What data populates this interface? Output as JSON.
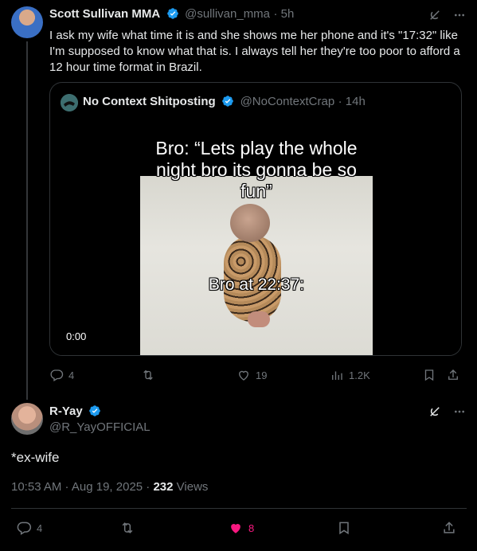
{
  "tweet": {
    "author_name": "Scott Sullivan MMA",
    "author_handle": "@sullivan_mma",
    "time": "· 5h",
    "text": "I ask my wife what time it is and she shows me her phone and it's \"17:32\" like I'm supposed to know what that is. I always tell her they're too poor to afford a 12 hour time format in Brazil.",
    "quote": {
      "author_name": "No Context Shitposting",
      "author_handle": "@NoContextCrap",
      "time": "· 14h",
      "caption_top": "Bro: “Lets play the whole night bro its gonna be so fun”",
      "caption_mid": "Bro at 22:37:",
      "video_time": "0:00"
    },
    "actions": {
      "replies": "4",
      "reposts": "",
      "likes": "19",
      "views": "1.2K"
    }
  },
  "reply": {
    "author_name": "R-Yay",
    "author_handle": "@R_YayOFFICIAL",
    "text": "*ex-wife",
    "timestamp": "10:53 AM · Aug 19, 2025 · ",
    "views_count": "232",
    "views_label": " Views",
    "actions": {
      "replies": "4",
      "reposts": "",
      "likes": "8"
    }
  },
  "colors": {
    "background": "#000000",
    "text": "#e7e9ea",
    "muted": "#71767b",
    "border": "#2f3336",
    "verified": "#1d9bf0",
    "like": "#f91880"
  },
  "icons": [
    "verified-badge-icon",
    "grok-icon",
    "more-icon",
    "reply-icon",
    "repost-icon",
    "like-icon",
    "views-icon",
    "bookmark-icon",
    "share-icon"
  ]
}
